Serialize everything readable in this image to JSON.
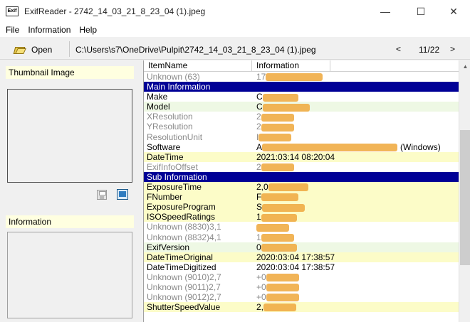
{
  "window": {
    "app_icon_text": "Exif",
    "title": "ExifReader - 2742_14_03_21_8_23_04 (1).jpeg",
    "minimize": "—",
    "maximize": "☐",
    "close": "✕"
  },
  "menu": [
    "File",
    "Information",
    "Help"
  ],
  "toolbar": {
    "open_label": "Open",
    "path": "C:\\Users\\s7\\OneDrive\\Pulpit\\2742_14_03_21_8_23_04 (1).jpeg",
    "prev": "<",
    "page": "11/22",
    "next": ">"
  },
  "left": {
    "thumbnail_header": "Thumbnail Image",
    "information_header": "Information"
  },
  "table": {
    "headers": [
      "ItemName",
      "Information"
    ],
    "rows": [
      {
        "name": "Unknown (63)",
        "value": "17",
        "style": "g",
        "blur": 80
      },
      {
        "name": "Main Information",
        "value": "",
        "style": "h",
        "blur": 0
      },
      {
        "name": "Make",
        "value": "C",
        "style": "w",
        "blur": 50
      },
      {
        "name": "Model",
        "value": "C",
        "style": "gr",
        "blur": 66
      },
      {
        "name": "XResolution",
        "value": "2",
        "style": "g",
        "blur": 46
      },
      {
        "name": "YResolution",
        "value": "2",
        "style": "g",
        "blur": 46
      },
      {
        "name": "ResolutionUnit",
        "value": "I",
        "style": "g",
        "blur": 46
      },
      {
        "name": "Software",
        "value": "A",
        "style": "w",
        "blur": 190,
        "suffix": "(Windows)"
      },
      {
        "name": "DateTime",
        "value": "2021:03:14 08:20:04",
        "style": "y",
        "blur": 0
      },
      {
        "name": "ExifInfoOffset",
        "value": "2",
        "style": "g",
        "blur": 46
      },
      {
        "name": "Sub Information",
        "value": "",
        "style": "h",
        "blur": 0
      },
      {
        "name": "ExposureTime",
        "value": "2,0",
        "style": "y",
        "blur": 56
      },
      {
        "name": "FNumber",
        "value": "F",
        "style": "y",
        "blur": 52
      },
      {
        "name": "ExposureProgram",
        "value": "S",
        "style": "y",
        "blur": 60
      },
      {
        "name": "ISOSpeedRatings",
        "value": "1",
        "style": "y",
        "blur": 50
      },
      {
        "name": "Unknown (8830)3,1",
        "value": "",
        "style": "g",
        "blur": 46
      },
      {
        "name": "Unknown (8832)4,1",
        "value": "1",
        "style": "g",
        "blur": 46
      },
      {
        "name": "ExifVersion",
        "value": "0",
        "style": "gr",
        "blur": 50
      },
      {
        "name": "DateTimeOriginal",
        "value": "2020:03:04 17:38:57",
        "style": "y",
        "blur": 0
      },
      {
        "name": "DateTimeDigitized",
        "value": "2020:03:04 17:38:57",
        "style": "w",
        "blur": 0
      },
      {
        "name": "Unknown (9010)2,7",
        "value": "+0",
        "style": "g",
        "blur": 46
      },
      {
        "name": "Unknown (9011)2,7",
        "value": "+0",
        "style": "g",
        "blur": 46
      },
      {
        "name": "Unknown (9012)2,7",
        "value": "+0",
        "style": "g",
        "blur": 46
      },
      {
        "name": "ShutterSpeedValue",
        "value": "2,",
        "style": "y",
        "blur": 46
      }
    ]
  },
  "colors": {
    "section_header": "#000096",
    "row_yellow": "#fcfcc8",
    "row_green": "#eef8e4",
    "redaction": "#f0ac45"
  }
}
